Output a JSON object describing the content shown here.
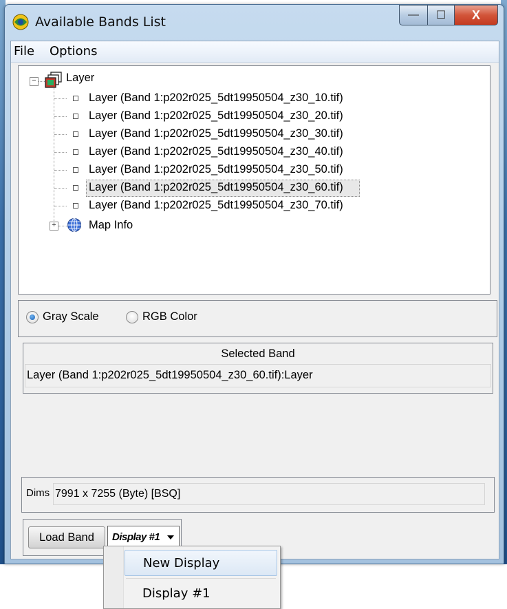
{
  "window": {
    "title": "Available Bands List",
    "controls": {
      "minimize": "—",
      "maximize": "☐",
      "close": "X"
    }
  },
  "menu": {
    "file": "File",
    "options": "Options"
  },
  "tree": {
    "root_label": "Layer",
    "root_toggle": "−",
    "bands": [
      "Layer (Band 1:p202r025_5dt19950504_z30_10.tif)",
      "Layer (Band 1:p202r025_5dt19950504_z30_20.tif)",
      "Layer (Band 1:p202r025_5dt19950504_z30_30.tif)",
      "Layer (Band 1:p202r025_5dt19950504_z30_40.tif)",
      "Layer (Band 1:p202r025_5dt19950504_z30_50.tif)",
      "Layer (Band 1:p202r025_5dt19950504_z30_60.tif)",
      "Layer (Band 1:p202r025_5dt19950504_z30_70.tif)"
    ],
    "selected_index": 5,
    "map_info_label": "Map Info",
    "map_info_toggle": "+"
  },
  "color_mode": {
    "gray_scale": "Gray Scale",
    "rgb_color": "RGB Color",
    "selected": "gray_scale"
  },
  "selected_band": {
    "title": "Selected Band",
    "value": "Layer (Band 1:p202r025_5dt19950504_z30_60.tif):Layer"
  },
  "dims": {
    "label": "Dims",
    "value": "7991 x 7255 (Byte) [BSQ]"
  },
  "buttons": {
    "load_band": "Load Band",
    "display": "Display #1"
  },
  "dropdown": {
    "items": [
      "New Display",
      "Display #1"
    ],
    "highlighted": 0
  },
  "colors": {
    "title_bar": "#aecbe6",
    "accent": "#1a5fb4",
    "close_button": "#c43a1f"
  }
}
